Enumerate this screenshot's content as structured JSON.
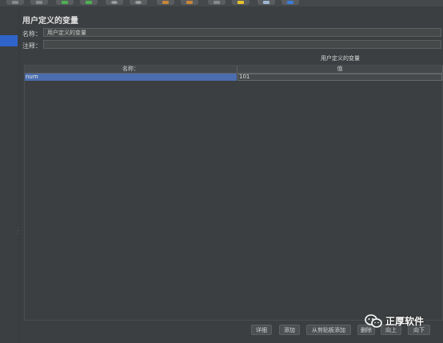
{
  "toolbar": {
    "buttons": [
      {
        "name": "toolbar-button-1",
        "color": "#8a8a8a"
      },
      {
        "name": "toolbar-button-2",
        "color": "#8a8a8a"
      },
      {
        "name": "run-button",
        "color": "#4caf50"
      },
      {
        "name": "run-no-pause-button",
        "color": "#4caf50"
      },
      {
        "name": "stop-button",
        "color": "#9e9e9e"
      },
      {
        "name": "shutdown-button",
        "color": "#9e9e9e"
      },
      {
        "name": "clear-button",
        "color": "#c8843a"
      },
      {
        "name": "clear-all-button",
        "color": "#c8843a"
      },
      {
        "name": "search-button",
        "color": "#8a8a8a"
      },
      {
        "name": "reset-search-button",
        "color": "#e6c229"
      },
      {
        "name": "function-helper-button",
        "color": "#9fb7d1"
      },
      {
        "name": "help-button",
        "color": "#3d7bd8"
      }
    ]
  },
  "panel": {
    "title": "用户定义的变量",
    "name_label": "名称：",
    "name_value": "用户定义的变量",
    "comment_label": "注释：",
    "comment_value": ""
  },
  "table": {
    "caption": "用户定义的变量",
    "columns": [
      "名称：",
      "值"
    ],
    "rows": [
      {
        "name": "num",
        "value": "101"
      }
    ]
  },
  "buttons": {
    "detail": "详细",
    "add": "添加",
    "add_from_clipboard": "从剪贴板添加",
    "delete": "删除",
    "up": "向上",
    "down": "向下"
  },
  "watermark": {
    "text": "正厚软件"
  }
}
